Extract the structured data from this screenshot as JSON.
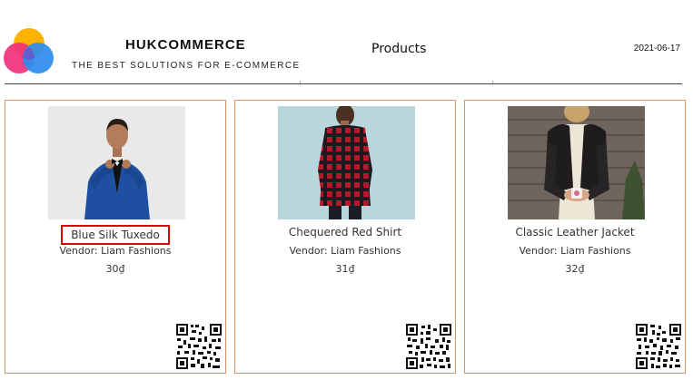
{
  "header": {
    "logo_icon": "hukcommerce-logo-icon",
    "brand_name": "HUKCOMMERCE",
    "tagline": "THE BEST SOLUTIONS FOR E-COMMERCE",
    "page_heading": "Products",
    "date": "2021-06-17"
  },
  "colors": {
    "card_border": "#d9916a",
    "highlight_border": "#e10000",
    "logo_yellow": "#ffb300",
    "logo_pink": "#f0307c",
    "logo_blue": "#2d8cf0"
  },
  "products": [
    {
      "name": "Blue Silk Tuxedo",
      "vendor": "Vendor: Liam Fashions",
      "price": "30₫",
      "image_icon": "blue-tuxedo-photo",
      "qr_icon": "qr-code-icon",
      "highlighted": true
    },
    {
      "name": "Chequered Red Shirt",
      "vendor": "Vendor: Liam Fashions",
      "price": "31₫",
      "image_icon": "red-shirt-photo",
      "qr_icon": "qr-code-icon",
      "highlighted": false
    },
    {
      "name": "Classic Leather Jacket",
      "vendor": "Vendor: Liam Fashions",
      "price": "32₫",
      "image_icon": "leather-jacket-photo",
      "qr_icon": "qr-code-icon",
      "highlighted": false
    }
  ]
}
